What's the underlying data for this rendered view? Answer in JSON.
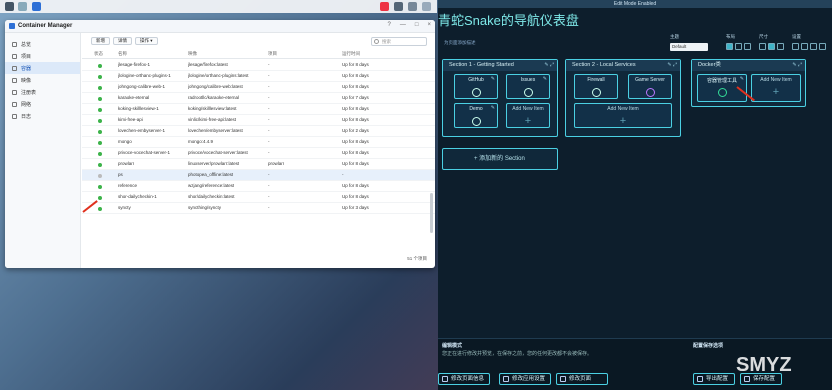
{
  "container_manager": {
    "title": "Container Manager",
    "window_buttons": [
      "?",
      "—",
      "□",
      "×"
    ],
    "sidebar": [
      {
        "label": "总览",
        "active": false
      },
      {
        "label": "项目",
        "active": false
      },
      {
        "label": "容器",
        "active": true
      },
      {
        "label": "映像",
        "active": false
      },
      {
        "label": "注册表",
        "active": false
      },
      {
        "label": "网络",
        "active": false
      },
      {
        "label": "日志",
        "active": false
      }
    ],
    "toolbar": {
      "new": "新增",
      "details": "详情",
      "action": "操作 ▾",
      "search_placeholder": "搜索"
    },
    "columns": [
      "状态",
      "名称",
      "映像",
      "项目",
      "运行时间"
    ],
    "rows": [
      {
        "status": "running",
        "name": "jlesage-firefox-1",
        "image": "jlesage/firefox:latest",
        "project": "-",
        "uptime": "Up for 8 days"
      },
      {
        "status": "running",
        "name": "jlologine-orthanc-plugins-1",
        "image": "jlologine/orthanc-plugins:latest",
        "project": "-",
        "uptime": "Up for 8 days"
      },
      {
        "status": "running",
        "name": "johngong-calibre-web-1",
        "image": "johngong/calibre-web:latest",
        "project": "-",
        "uptime": "Up for 8 days"
      },
      {
        "status": "running",
        "name": "karaoke-eternal",
        "image": "radrootllc/karaoke-eternal",
        "project": "-",
        "uptime": "Up for 7 days"
      },
      {
        "status": "running",
        "name": "koking-skilllesview-1",
        "image": "koking/skilllesview:latest",
        "project": "-",
        "uptime": "Up for 8 days"
      },
      {
        "status": "running",
        "name": "kimi-free-api",
        "image": "vinlic/kimi-free-api:latest",
        "project": "-",
        "uptime": "Up for 8 days"
      },
      {
        "status": "running",
        "name": "lovechen-embyserver-1",
        "image": "lovechen/embyserver:latest",
        "project": "-",
        "uptime": "Up for 2 days"
      },
      {
        "status": "running",
        "name": "mongo",
        "image": "mongo:4.4.9",
        "project": "-",
        "uptime": "Up for 8 days"
      },
      {
        "status": "running",
        "name": "privoce-vocechat-server-1",
        "image": "privoce/vocechat-server:latest",
        "project": "-",
        "uptime": "Up for 8 days"
      },
      {
        "status": "running",
        "name": "prowlarr",
        "image": "linuxserver/prowlarr:latest",
        "project": "prowlarr",
        "uptime": "Up for 8 days"
      },
      {
        "status": "stopped",
        "name": "ps",
        "image": "photopea_offline:latest",
        "project": "-",
        "uptime": "-",
        "selected": true
      },
      {
        "status": "running",
        "name": "reference",
        "image": "wzjang/reference:latest",
        "project": "-",
        "uptime": "Up for 8 days"
      },
      {
        "status": "running",
        "name": "shor-dailycheckin-1",
        "image": "shor/dailycheckin:latest",
        "project": "-",
        "uptime": "Up for 8 days"
      },
      {
        "status": "running",
        "name": "syncty",
        "image": "syncthing/syncty",
        "project": "-",
        "uptime": "Up for 3 days"
      }
    ],
    "footer": "51 个项目"
  },
  "dashboard": {
    "edit_banner": "Edit Mode Enabled",
    "title": "青蛇Snake的导航仪表盘",
    "subtitle_placeholder": "为页面添加描述",
    "settings": {
      "theme_label": "主题",
      "theme_value": "Default",
      "layout_label": "布局",
      "size_label": "尺寸",
      "config_label": "设置"
    },
    "sections": [
      {
        "name": "Section 1 - Getting Started",
        "tiles": [
          "GitHub",
          "Issues",
          "Demo",
          "Add New Item"
        ]
      },
      {
        "name": "Section 2 - Local Services",
        "tiles": [
          "Firewall",
          "Game Server",
          "Add New Item"
        ]
      },
      {
        "name": "Docker类",
        "tiles": [
          "容器管理工具",
          "Add New Item"
        ]
      }
    ],
    "add_section": "+ 添加新的 Section",
    "bottom": {
      "mode_label": "编辑模式",
      "mode_desc": "您正在进行修改并预览，在保存之前，您的任何更改都不会被保存。",
      "config_label": "配置保存选项",
      "btn_edit_page": "修改页面信息",
      "btn_app_settings": "修改应用设置",
      "btn_page": "修改页面",
      "btn_export": "导出配置",
      "btn_save": "保存配置",
      "watermark": "SMYZ"
    }
  },
  "colors": {
    "accent": "#4bd0e3",
    "running": "#3cb34a",
    "arrow": "#e0301e"
  }
}
